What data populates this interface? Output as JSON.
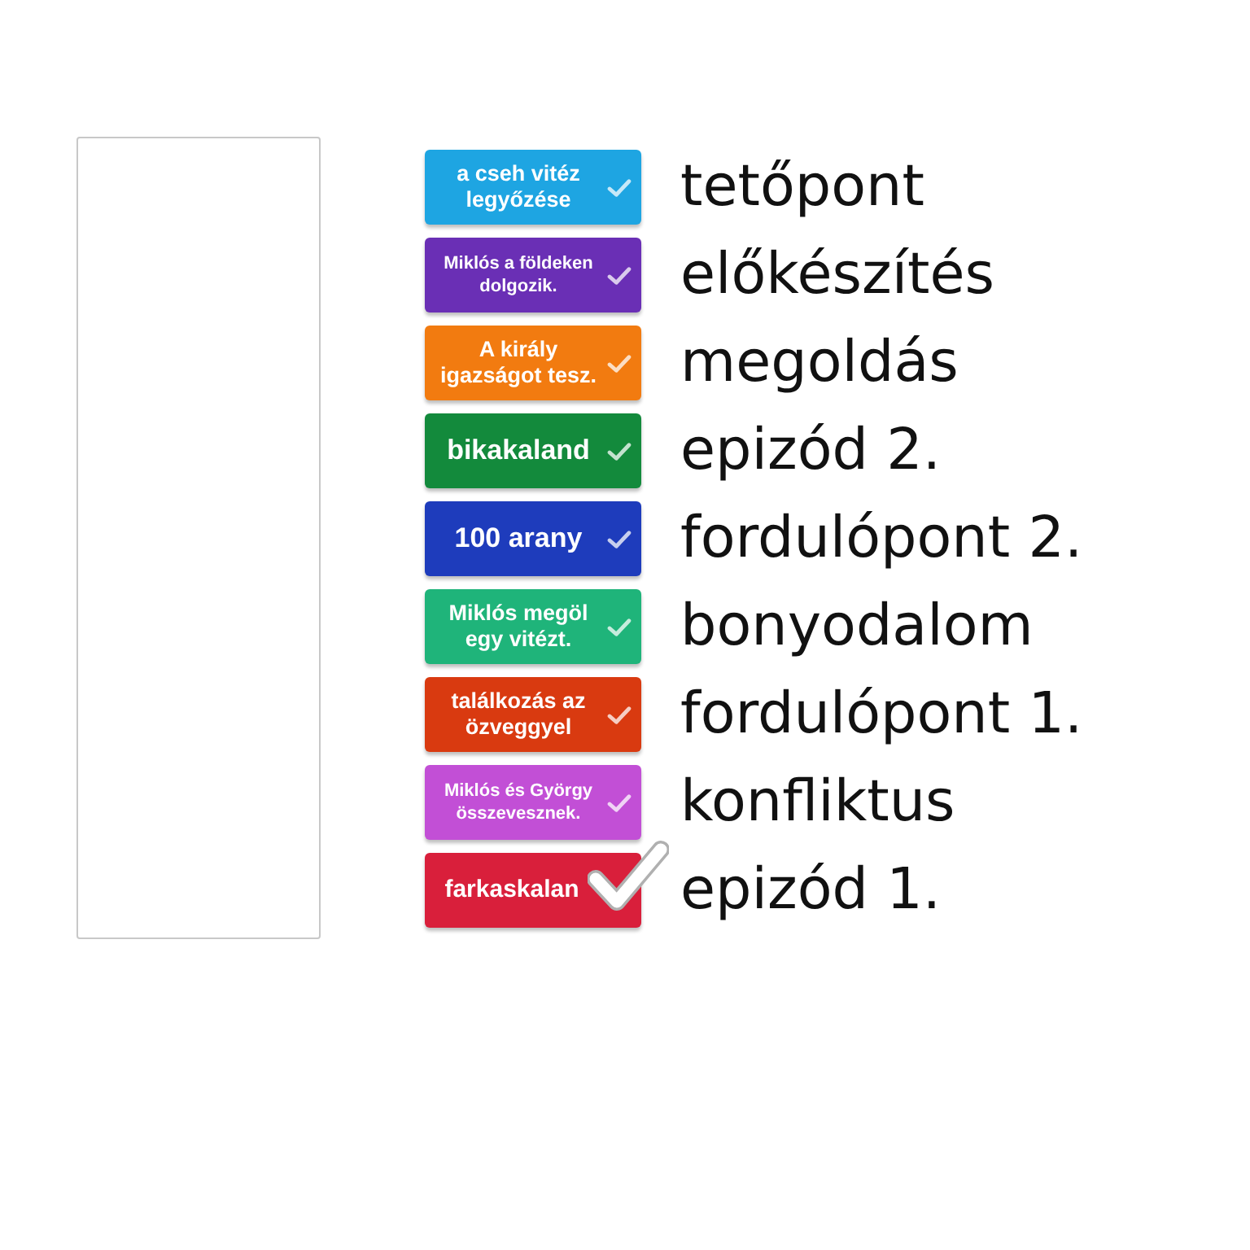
{
  "cards": [
    {
      "text": "a cseh vitéz legyőzése",
      "color": "#1ea5e2",
      "selected": false
    },
    {
      "text": "Miklós a földeken dolgozik.",
      "color": "#6a2fb5",
      "selected": false
    },
    {
      "text": "A király igazságot tesz.",
      "color": "#f27b10",
      "selected": false
    },
    {
      "text": "bikakaland",
      "color": "#138a3c",
      "selected": false
    },
    {
      "text": "100 arany",
      "color": "#1e3cbc",
      "selected": false
    },
    {
      "text": "Miklós megöl egy vitézt.",
      "color": "#1fb47a",
      "selected": false
    },
    {
      "text": "találkozás az özveggyel",
      "color": "#d93a10",
      "selected": false
    },
    {
      "text": "Miklós és György összevesznek.",
      "color": "#c24fd6",
      "selected": false
    },
    {
      "text": "farkaskalan",
      "color": "#d91f3b",
      "selected": true
    }
  ],
  "labels": [
    "tetőpont",
    "előkészítés",
    "megoldás",
    "epizód 2.",
    "fordulópont 2.",
    "bonyodalom",
    "fordulópont 1.",
    "konfliktus",
    "epizód 1."
  ]
}
